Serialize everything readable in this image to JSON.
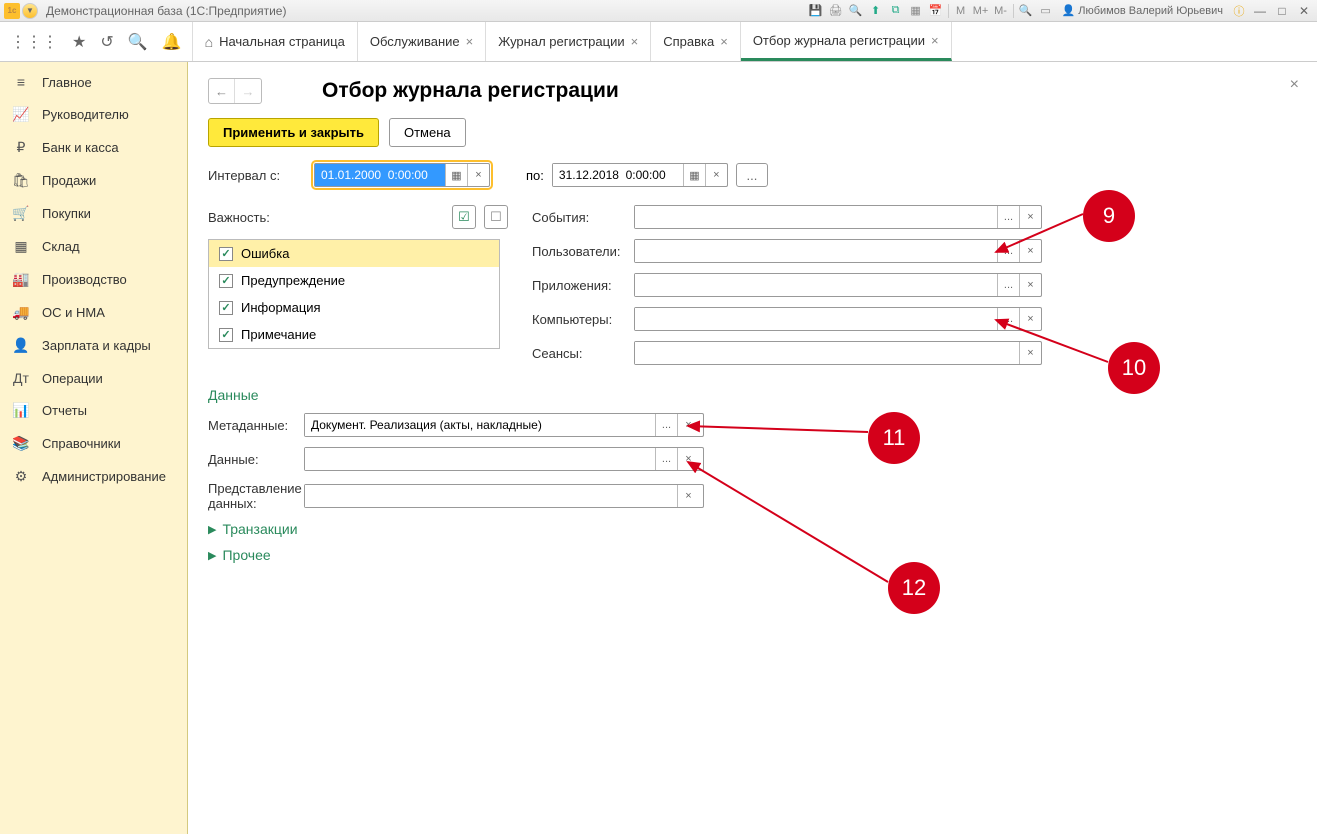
{
  "titlebar": {
    "app_title": "Демонстрационная база  (1С:Предприятие)",
    "user_name": "Любимов Валерий Юрьевич",
    "m_labels": [
      "M",
      "M+",
      "M-"
    ]
  },
  "tabs": {
    "home": "Начальная страница",
    "t1": "Обслуживание",
    "t2": "Журнал регистрации",
    "t3": "Справка",
    "t4": "Отбор журнала регистрации"
  },
  "sidebar": {
    "items": [
      {
        "label": "Главное",
        "icon": "≡"
      },
      {
        "label": "Руководителю",
        "icon": "📈"
      },
      {
        "label": "Банк и касса",
        "icon": "₽"
      },
      {
        "label": "Продажи",
        "icon": "🛍"
      },
      {
        "label": "Покупки",
        "icon": "🛒"
      },
      {
        "label": "Склад",
        "icon": "▦"
      },
      {
        "label": "Производство",
        "icon": "🏭"
      },
      {
        "label": "ОС и НМА",
        "icon": "🚚"
      },
      {
        "label": "Зарплата и кадры",
        "icon": "👤"
      },
      {
        "label": "Операции",
        "icon": "Дт"
      },
      {
        "label": "Отчеты",
        "icon": "📊"
      },
      {
        "label": "Справочники",
        "icon": "📚"
      },
      {
        "label": "Администрирование",
        "icon": "⚙"
      }
    ]
  },
  "page": {
    "title": "Отбор журнала регистрации",
    "btn_apply": "Применить и закрыть",
    "btn_cancel": "Отмена",
    "lbl_interval_from": "Интервал с:",
    "val_from": "01.01.2000  0:00:00",
    "lbl_interval_to": "по:",
    "val_to": "31.12.2018  0:00:00",
    "lbl_importance": "Важность:",
    "importance_items": [
      "Ошибка",
      "Предупреждение",
      "Информация",
      "Примечание"
    ],
    "lbl_events": "События:",
    "lbl_users": "Пользователи:",
    "lbl_apps": "Приложения:",
    "lbl_computers": "Компьютеры:",
    "lbl_sessions": "Сеансы:",
    "section_data": "Данные",
    "lbl_metadata": "Метаданные:",
    "val_metadata": "Документ. Реализация (акты, накладные)",
    "lbl_data": "Данные:",
    "lbl_repr": "Представление данных:",
    "sec_trans": "Транзакции",
    "sec_other": "Прочее"
  },
  "annotations": {
    "a9": "9",
    "a10": "10",
    "a11": "11",
    "a12": "12"
  }
}
